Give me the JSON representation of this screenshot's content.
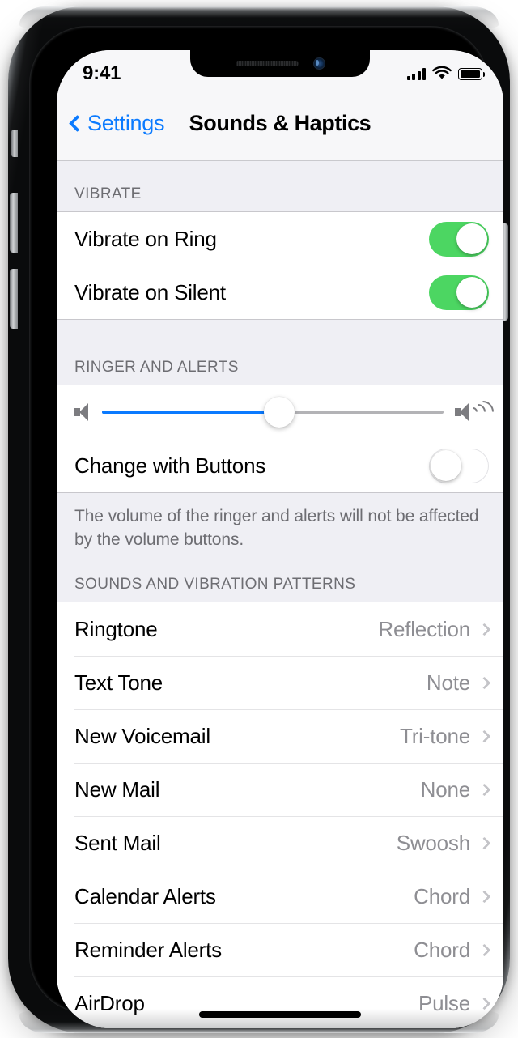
{
  "status_bar": {
    "time": "9:41",
    "cellular_icon": "signal-bars-icon",
    "wifi_icon": "wifi-icon",
    "battery_icon": "battery-full-icon"
  },
  "nav_bar": {
    "back_label": "Settings",
    "back_icon": "chevron-left-icon",
    "title": "Sounds & Haptics"
  },
  "sections": {
    "vibrate": {
      "header": "VIBRATE",
      "rows": [
        {
          "label": "Vibrate on Ring",
          "state": "on"
        },
        {
          "label": "Vibrate on Silent",
          "state": "on"
        }
      ]
    },
    "ringer": {
      "header": "RINGER AND ALERTS",
      "slider": {
        "value_percent": 52,
        "min_icon": "speaker-low-icon",
        "max_icon": "speaker-high-icon"
      },
      "change_with_buttons": {
        "label": "Change with Buttons",
        "state": "off"
      },
      "footer_note": "The volume of the ringer and alerts will not be affected by the volume buttons."
    },
    "sounds": {
      "header": "SOUNDS AND VIBRATION PATTERNS",
      "rows": [
        {
          "label": "Ringtone",
          "value": "Reflection"
        },
        {
          "label": "Text Tone",
          "value": "Note"
        },
        {
          "label": "New Voicemail",
          "value": "Tri-tone"
        },
        {
          "label": "New Mail",
          "value": "None"
        },
        {
          "label": "Sent Mail",
          "value": "Swoosh"
        },
        {
          "label": "Calendar Alerts",
          "value": "Chord"
        },
        {
          "label": "Reminder Alerts",
          "value": "Chord"
        },
        {
          "label": "AirDrop",
          "value": "Pulse"
        }
      ]
    }
  },
  "colors": {
    "accent_blue": "#0a7aff",
    "toggle_on_green": "#4cd662",
    "group_background": "#efeff4",
    "secondary_text": "#8e8e93"
  }
}
